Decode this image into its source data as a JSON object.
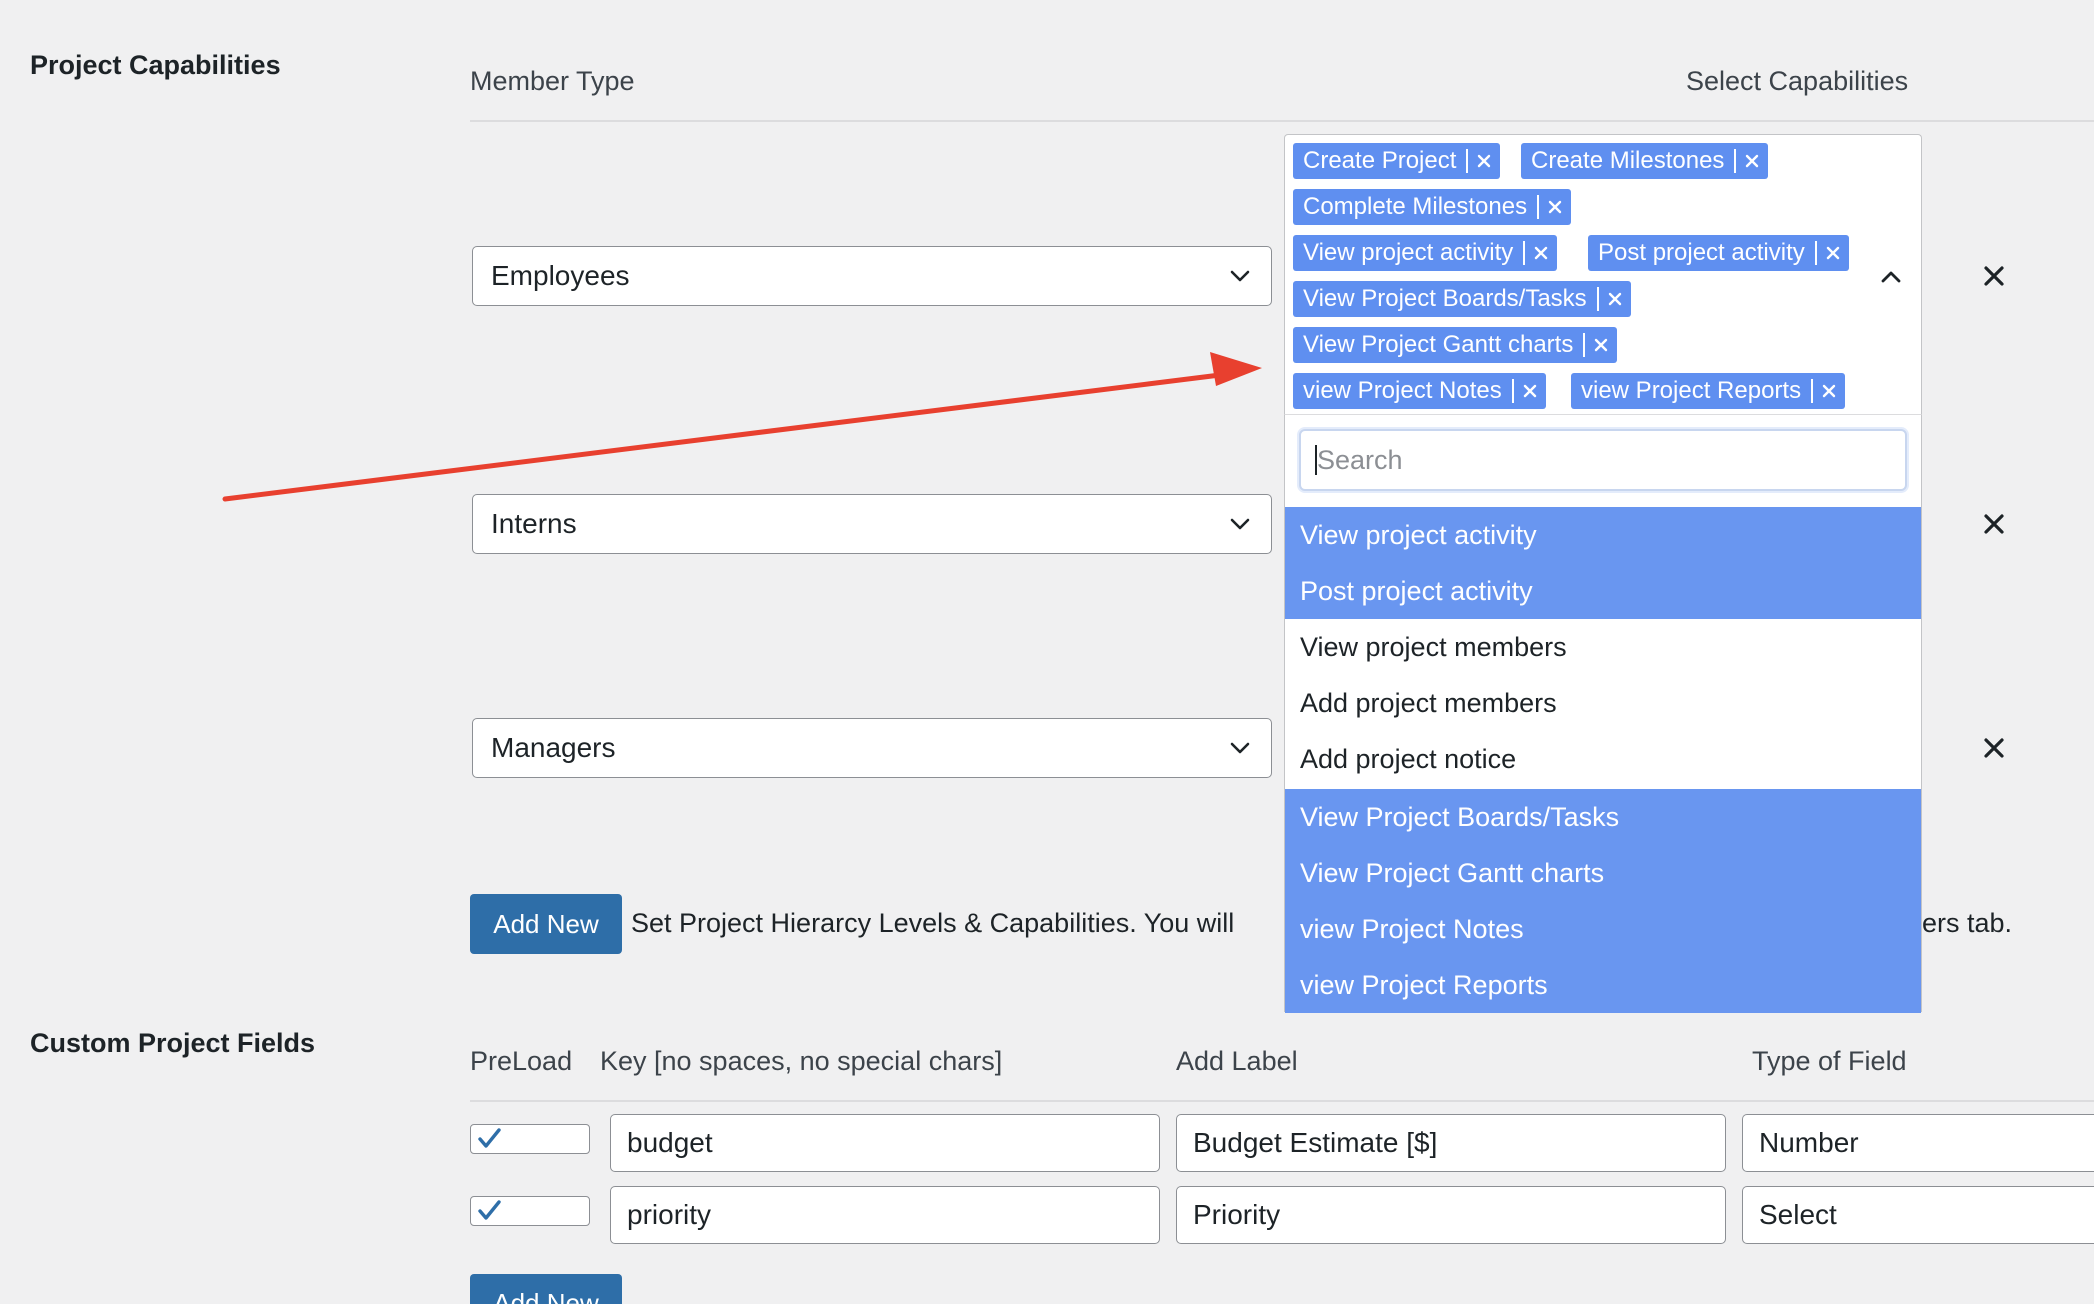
{
  "capabilities_section": {
    "title": "Project Capabilities",
    "col_member_type": "Member Type",
    "col_select_capabilities": "Select Capabilities",
    "rows": [
      {
        "member_type": "Employees"
      },
      {
        "member_type": "Interns"
      },
      {
        "member_type": "Managers"
      }
    ],
    "selected_tags": [
      "Create Project",
      "Create Milestones",
      "Complete Milestones",
      "View project activity",
      "Post project activity",
      "View Project Boards/Tasks",
      "View Project Gantt charts",
      "view Project Notes",
      "view Project Reports"
    ],
    "search_placeholder": "Search",
    "options": [
      {
        "label": "View project activity",
        "selected": true
      },
      {
        "label": "Post project activity",
        "selected": true
      },
      {
        "label": "View project members",
        "selected": false
      },
      {
        "label": "Add project members",
        "selected": false
      },
      {
        "label": "Add project notice",
        "selected": false
      },
      {
        "label": "View Project Boards/Tasks",
        "selected": true
      },
      {
        "label": "View Project Gantt charts",
        "selected": true
      },
      {
        "label": "view Project Notes",
        "selected": true
      },
      {
        "label": "view Project Reports",
        "selected": true
      }
    ],
    "add_new_label": "Add New",
    "help_text_left": "Set Project Hierarcy Levels & Capabilities. You will",
    "help_text_right": "ers tab."
  },
  "custom_fields_section": {
    "title": "Custom Project Fields",
    "col_preload": "PreLoad",
    "col_key": "Key [no spaces, no special chars]",
    "col_label": "Add Label",
    "col_type": "Type of Field",
    "rows": [
      {
        "preload": true,
        "key": "budget",
        "label": "Budget Estimate [$]",
        "type": "Number"
      },
      {
        "preload": true,
        "key": "priority",
        "label": "Priority",
        "type": "Select"
      }
    ],
    "add_new_label": "Add New"
  },
  "colors": {
    "tag_bg": "#5f8ff0",
    "option_selected_bg": "#6996f0",
    "primary_button": "#2e6ea8",
    "annotation_arrow": "#e8402f"
  },
  "icons": {
    "select_arrow": "chevron-down-icon",
    "capbox_toggle": "chevron-up-icon",
    "remove_row": "close-icon",
    "remove_tag": "close-icon",
    "checkbox": "checkmark-icon"
  }
}
